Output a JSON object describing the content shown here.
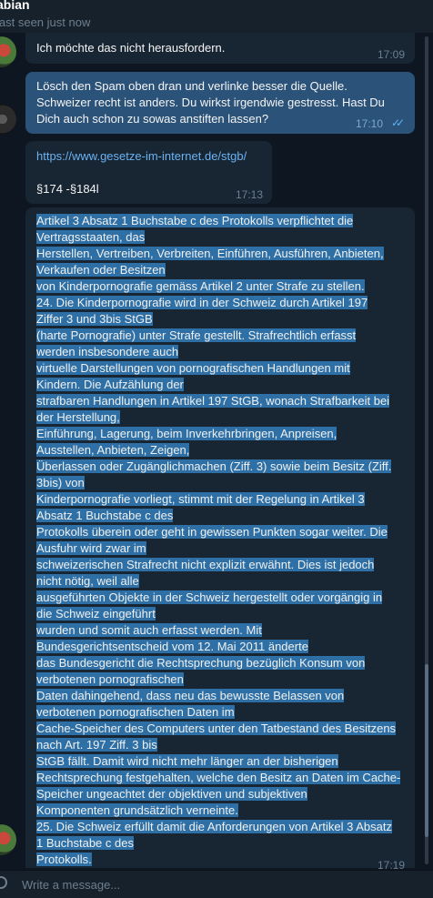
{
  "chat": {
    "name": "abian",
    "status": "last seen just now"
  },
  "messages": [
    {
      "text": "Ich möchte das nicht herausfordern.",
      "time": "17:09"
    },
    {
      "lines": [
        "Lösch den Spam oben dran und verlinke besser die Quelle.",
        "Schweizer recht ist anders. Du wirkst irgendwie gestresst. Hast Du",
        "Dich auch schon zu sowas anstiften lassen?"
      ],
      "time": "17:10"
    },
    {
      "link": "https://www.gesetze-im-internet.de/stgb/",
      "text": "§174 -§184l",
      "time": "17:13"
    },
    {
      "lines": [
        "Artikel 3 Absatz 1 Buchstabe c des Protokolls verpflichtet die",
        "Vertragsstaaten, das",
        "Herstellen, Vertreiben, Verbreiten, Einführen, Ausführen, Anbieten,",
        "Verkaufen oder Besitzen",
        "von Kinderpornografie gemäss Artikel 2 unter Strafe zu stellen.",
        "24. Die Kinderpornografie wird in der Schweiz durch Artikel 197",
        "Ziffer 3 und 3bis StGB",
        "(harte Pornografie) unter Strafe gestellt. Strafrechtlich erfasst",
        "werden insbesondere auch",
        "virtuelle Darstellungen von pornografischen Handlungen mit",
        "Kindern. Die Aufzählung der",
        "strafbaren Handlungen in Artikel 197 StGB, wonach Strafbarkeit bei",
        "der Herstellung,",
        "Einführung, Lagerung, beim Inverkehrbringen, Anpreisen,",
        "Ausstellen, Anbieten, Zeigen,",
        "Überlassen oder Zugänglichmachen (Ziff. 3) sowie beim Besitz (Ziff.",
        "3bis) von",
        "Kinderpornografie vorliegt, stimmt mit der Regelung in Artikel 3",
        "Absatz 1 Buchstabe c des",
        "Protokolls überein oder geht in gewissen Punkten sogar weiter. Die",
        "Ausfuhr wird zwar im",
        "schweizerischen Strafrecht nicht explizit erwähnt. Dies ist jedoch",
        "nicht nötig, weil alle",
        "ausgeführten Objekte in der Schweiz hergestellt oder vorgängig in",
        "die Schweiz eingeführt",
        "wurden und somit auch erfasst werden. Mit",
        "Bundesgerichtsentscheid vom 12. Mai 2011 änderte",
        "das Bundesgericht die Rechtsprechung bezüglich Konsum von",
        "verbotenen pornografischen",
        "Daten dahingehend, dass neu das bewusste Belassen von",
        "verbotenen pornografischen Daten im",
        "Cache-Speicher des Computers unter den Tatbestand des Besitzens",
        "nach Art. 197 Ziff. 3 bis",
        "StGB fällt. Damit wird nicht mehr länger an der bisherigen",
        "Rechtsprechung festgehalten, welche den Besitz an Daten im Cache-",
        "Speicher ungeachtet der objektiven und subjektiven",
        "Komponenten grundsätzlich verneinte.",
        "25. Die Schweiz erfüllt damit die Anforderungen von Artikel 3 Absatz",
        "1 Buchstabe c des",
        "Protokolls."
      ],
      "time": "17:19"
    }
  ],
  "composer": {
    "placeholder": "Write a message..."
  },
  "colors": {
    "background": "#0e1621",
    "incoming": "#182533",
    "outgoing": "#2b5278",
    "selection": "#2e70a6",
    "link": "#6ab3f3"
  }
}
